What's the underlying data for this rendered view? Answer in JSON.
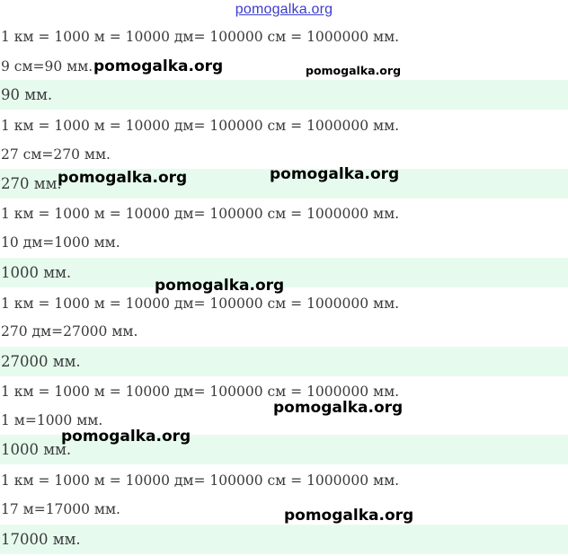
{
  "header": {
    "site_link": "pomogalka.org"
  },
  "lines": [
    "1 км = 1000 м = 10000 дм= 100000 см = 1000000 мм.",
    "9 см=90 мм.",
    "90 мм.",
    "1 км = 1000 м = 10000 дм= 100000 см = 1000000 мм.",
    "27 см=270 мм.",
    "270 мм.",
    "1 км = 1000 м = 10000 дм= 100000 см = 1000000 мм.",
    "10 дм=1000 мм.",
    "1000 мм.",
    "1 км = 1000 м = 10000 дм= 100000 см = 1000000 мм.",
    "270 дм=27000 мм.",
    "27000 мм.",
    "1 км = 1000 м = 10000 дм= 100000 см = 1000000 мм.",
    "1 м=1000 мм.",
    "1000 мм.",
    "1 км = 1000 м = 10000 дм= 100000 см = 1000000 мм.",
    "17 м=17000 мм.",
    "17000 мм."
  ],
  "watermarks": [
    "pomogalka.org",
    "pomogalka.org",
    "pomogalka.org",
    "pomogalka.org",
    "pomogalka.org",
    "pomogalka.org",
    "pomogalka.org",
    "pomogalka.org"
  ],
  "colors": {
    "answer_background": "#e6fbee",
    "text": "#3a3a3a",
    "header_link": "#3c3ccf"
  }
}
